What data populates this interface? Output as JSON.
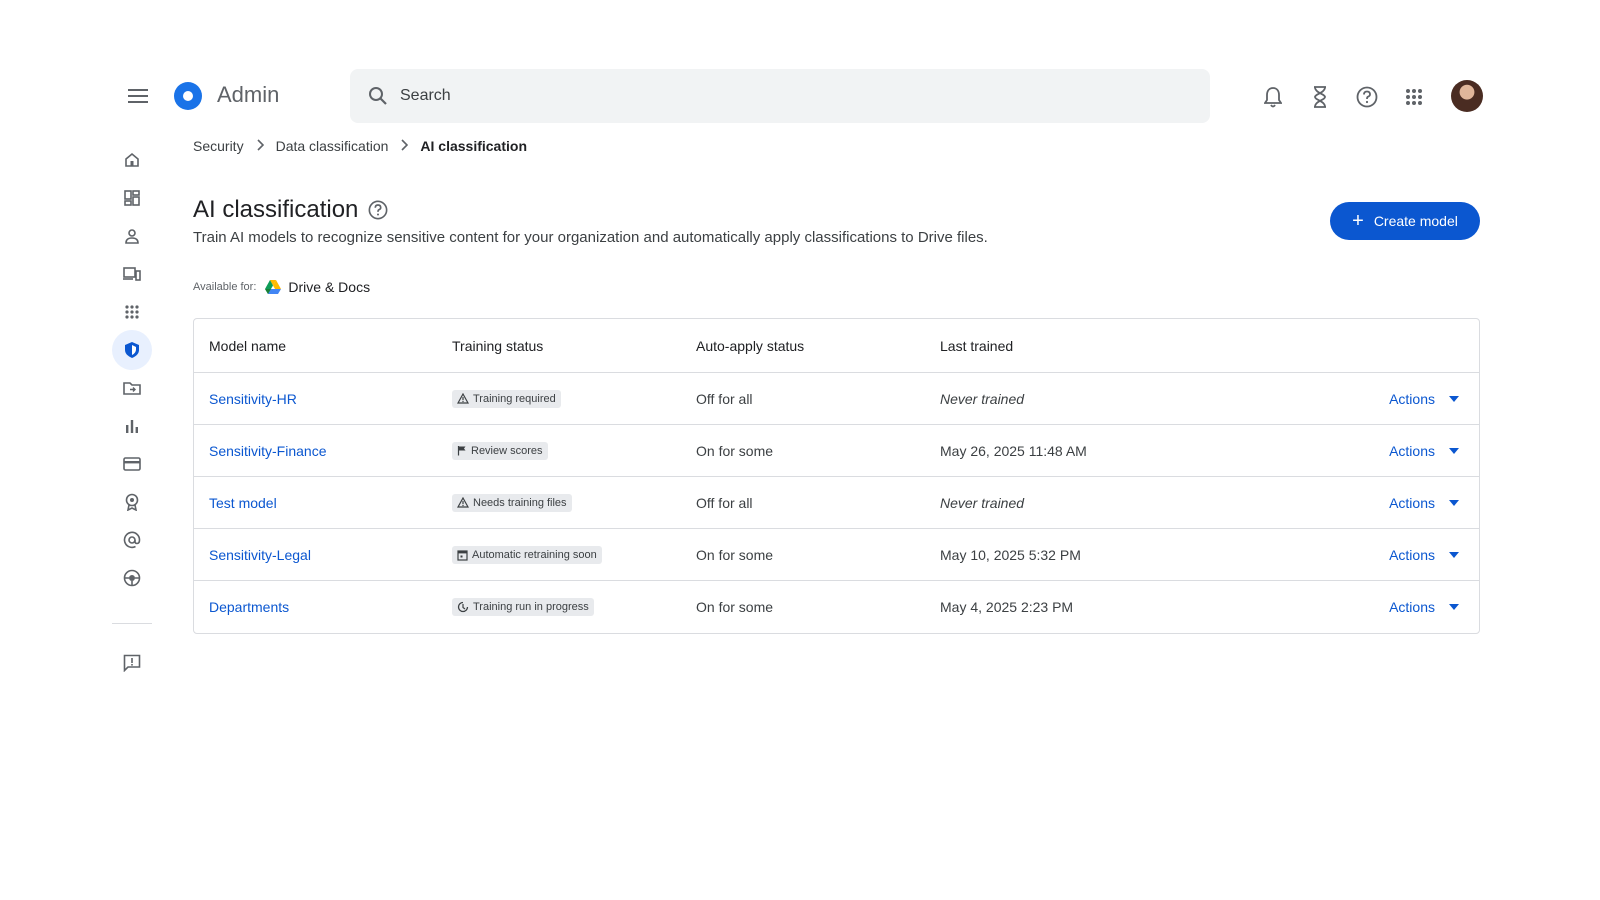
{
  "app": {
    "title": "Admin"
  },
  "search": {
    "placeholder": "Search"
  },
  "topbar": {
    "icons": [
      "notifications-icon",
      "hourglass-icon",
      "help-icon",
      "apps-grid-icon"
    ]
  },
  "rail": {
    "items": [
      "home-icon",
      "dashboard-icon",
      "user-icon",
      "devices-icon",
      "apps-icon",
      "security-shield-icon",
      "folder-icon",
      "reports-icon",
      "billing-icon",
      "rules-icon",
      "account-at-icon",
      "support-icon"
    ],
    "feedback": "feedback-icon"
  },
  "breadcrumb": {
    "items": [
      "Security",
      "Data classification"
    ],
    "current": "AI classification"
  },
  "page": {
    "title": "AI classification",
    "description": "Train AI models to recognize sensitive content for your organization and automatically apply classifications to Drive files.",
    "available_label": "Available for:",
    "available_product": "Drive & Docs",
    "create_button": "Create model"
  },
  "colors": {
    "accent": "#0b57d0",
    "chip_bg": "#e8eaed"
  },
  "table": {
    "headers": [
      "Model name",
      "Training status",
      "Auto-apply status",
      "Last trained"
    ],
    "rows": [
      {
        "name": "Sensitivity-HR",
        "status": "Training required",
        "status_icon": "warning-icon",
        "auto": "Off for all",
        "last": "Never trained",
        "last_italic": true,
        "actions": "Actions"
      },
      {
        "name": "Sensitivity-Finance",
        "status": "Review scores",
        "status_icon": "flag-icon",
        "auto": "On for some",
        "last": "May 26, 2025 11:48 AM",
        "last_italic": false,
        "actions": "Actions"
      },
      {
        "name": "Test model",
        "status": "Needs training files",
        "status_icon": "warning-icon",
        "auto": "Off for all",
        "last": "Never trained",
        "last_italic": true,
        "actions": "Actions"
      },
      {
        "name": "Sensitivity-Legal",
        "status": "Automatic retraining soon",
        "status_icon": "calendar-icon",
        "auto": "On for some",
        "last": "May 10, 2025 5:32 PM",
        "last_italic": false,
        "actions": "Actions"
      },
      {
        "name": "Departments",
        "status": "Training run in progress",
        "status_icon": "progress-icon",
        "auto": "On for some",
        "last": "May 4, 2025 2:23 PM",
        "last_italic": false,
        "actions": "Actions"
      }
    ]
  }
}
